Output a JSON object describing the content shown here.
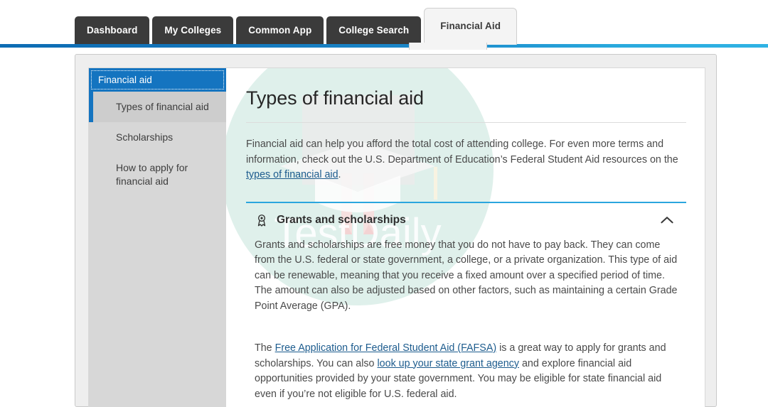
{
  "tabs": [
    {
      "label": "Dashboard",
      "active": false
    },
    {
      "label": "My Colleges",
      "active": false
    },
    {
      "label": "Common App",
      "active": false
    },
    {
      "label": "College Search",
      "active": false
    },
    {
      "label": "Financial Aid",
      "active": true
    }
  ],
  "sidebar": {
    "header": "Financial aid",
    "items": [
      {
        "label": "Types of financial aid",
        "active": true
      },
      {
        "label": "Scholarships",
        "active": false
      },
      {
        "label": "How to apply for financial aid",
        "active": false
      }
    ]
  },
  "main": {
    "title": "Types of financial aid",
    "intro": {
      "before_link": "Financial aid can help you afford the total cost of attending college. For even more terms and information, check out the U.S. Department of Education’s Federal Student Aid resources on the ",
      "link": "types of financial aid",
      "after_link": "."
    },
    "accordion": {
      "icon": "award-ribbon-icon",
      "title": "Grants and scholarships",
      "toggle_icon": "chevron-up-icon",
      "expanded": true,
      "paragraph_1": "Grants and scholarships are free money that you do not have to pay back. They can come from the U.S. federal or state government, a college, or a private organization. This type of aid can be renewable, meaning that you receive a fixed amount over a specified period of time. The amount can also be adjusted based on other factors, such as maintaining a certain Grade Point Average (GPA).",
      "paragraph_2": {
        "s1": "The ",
        "link1": "Free Application for Federal Student Aid (FAFSA)",
        "s2": " is a great way to apply for grants and scholarships. You can also ",
        "link2": "look up your state grant agency",
        "s3": " and explore financial aid opportunities provided by your state government. You may be eligible for state financial aid even if you’re not eligible for U.S. federal aid."
      }
    }
  },
  "watermark": {
    "text": "TestDaily"
  },
  "colors": {
    "tab_inactive_bg": "#3b3b3b",
    "tab_active_bg": "#f4f4f4",
    "rule_blue_left": "#0d6cb4",
    "rule_blue_right": "#2fb3e4",
    "sidebar_header_blue": "#1474c0",
    "sidebar_bg": "#d7d7d7",
    "sidebar_active_bg": "#cdcdcd",
    "accordion_top_border": "#2ba6de",
    "link": "#1d5c8e",
    "watermark_circle": "#dff0eb"
  }
}
